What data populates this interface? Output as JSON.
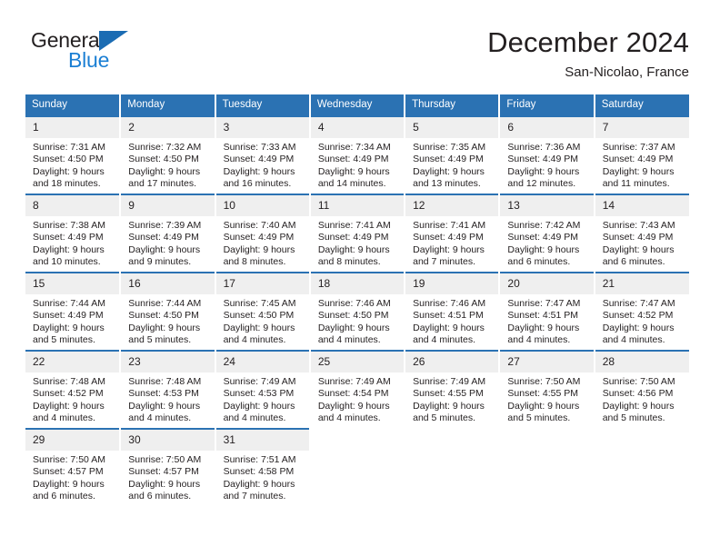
{
  "brand": {
    "line1": "General",
    "line2": "Blue",
    "triangle_color": "#1b6cb3",
    "line2_color": "#1b7fd4"
  },
  "header": {
    "title": "December 2024",
    "subtitle": "San-Nicolao, France"
  },
  "colors": {
    "header_blue": "#2b72b3",
    "daynum_band": "#efefef",
    "text": "#231f20"
  },
  "weekday_headers": [
    "Sunday",
    "Monday",
    "Tuesday",
    "Wednesday",
    "Thursday",
    "Friday",
    "Saturday"
  ],
  "weeks": [
    [
      {
        "day": "1",
        "sunrise": "Sunrise: 7:31 AM",
        "sunset": "Sunset: 4:50 PM",
        "daylight1": "Daylight: 9 hours",
        "daylight2": "and 18 minutes."
      },
      {
        "day": "2",
        "sunrise": "Sunrise: 7:32 AM",
        "sunset": "Sunset: 4:50 PM",
        "daylight1": "Daylight: 9 hours",
        "daylight2": "and 17 minutes."
      },
      {
        "day": "3",
        "sunrise": "Sunrise: 7:33 AM",
        "sunset": "Sunset: 4:49 PM",
        "daylight1": "Daylight: 9 hours",
        "daylight2": "and 16 minutes."
      },
      {
        "day": "4",
        "sunrise": "Sunrise: 7:34 AM",
        "sunset": "Sunset: 4:49 PM",
        "daylight1": "Daylight: 9 hours",
        "daylight2": "and 14 minutes."
      },
      {
        "day": "5",
        "sunrise": "Sunrise: 7:35 AM",
        "sunset": "Sunset: 4:49 PM",
        "daylight1": "Daylight: 9 hours",
        "daylight2": "and 13 minutes."
      },
      {
        "day": "6",
        "sunrise": "Sunrise: 7:36 AM",
        "sunset": "Sunset: 4:49 PM",
        "daylight1": "Daylight: 9 hours",
        "daylight2": "and 12 minutes."
      },
      {
        "day": "7",
        "sunrise": "Sunrise: 7:37 AM",
        "sunset": "Sunset: 4:49 PM",
        "daylight1": "Daylight: 9 hours",
        "daylight2": "and 11 minutes."
      }
    ],
    [
      {
        "day": "8",
        "sunrise": "Sunrise: 7:38 AM",
        "sunset": "Sunset: 4:49 PM",
        "daylight1": "Daylight: 9 hours",
        "daylight2": "and 10 minutes."
      },
      {
        "day": "9",
        "sunrise": "Sunrise: 7:39 AM",
        "sunset": "Sunset: 4:49 PM",
        "daylight1": "Daylight: 9 hours",
        "daylight2": "and 9 minutes."
      },
      {
        "day": "10",
        "sunrise": "Sunrise: 7:40 AM",
        "sunset": "Sunset: 4:49 PM",
        "daylight1": "Daylight: 9 hours",
        "daylight2": "and 8 minutes."
      },
      {
        "day": "11",
        "sunrise": "Sunrise: 7:41 AM",
        "sunset": "Sunset: 4:49 PM",
        "daylight1": "Daylight: 9 hours",
        "daylight2": "and 8 minutes."
      },
      {
        "day": "12",
        "sunrise": "Sunrise: 7:41 AM",
        "sunset": "Sunset: 4:49 PM",
        "daylight1": "Daylight: 9 hours",
        "daylight2": "and 7 minutes."
      },
      {
        "day": "13",
        "sunrise": "Sunrise: 7:42 AM",
        "sunset": "Sunset: 4:49 PM",
        "daylight1": "Daylight: 9 hours",
        "daylight2": "and 6 minutes."
      },
      {
        "day": "14",
        "sunrise": "Sunrise: 7:43 AM",
        "sunset": "Sunset: 4:49 PM",
        "daylight1": "Daylight: 9 hours",
        "daylight2": "and 6 minutes."
      }
    ],
    [
      {
        "day": "15",
        "sunrise": "Sunrise: 7:44 AM",
        "sunset": "Sunset: 4:49 PM",
        "daylight1": "Daylight: 9 hours",
        "daylight2": "and 5 minutes."
      },
      {
        "day": "16",
        "sunrise": "Sunrise: 7:44 AM",
        "sunset": "Sunset: 4:50 PM",
        "daylight1": "Daylight: 9 hours",
        "daylight2": "and 5 minutes."
      },
      {
        "day": "17",
        "sunrise": "Sunrise: 7:45 AM",
        "sunset": "Sunset: 4:50 PM",
        "daylight1": "Daylight: 9 hours",
        "daylight2": "and 4 minutes."
      },
      {
        "day": "18",
        "sunrise": "Sunrise: 7:46 AM",
        "sunset": "Sunset: 4:50 PM",
        "daylight1": "Daylight: 9 hours",
        "daylight2": "and 4 minutes."
      },
      {
        "day": "19",
        "sunrise": "Sunrise: 7:46 AM",
        "sunset": "Sunset: 4:51 PM",
        "daylight1": "Daylight: 9 hours",
        "daylight2": "and 4 minutes."
      },
      {
        "day": "20",
        "sunrise": "Sunrise: 7:47 AM",
        "sunset": "Sunset: 4:51 PM",
        "daylight1": "Daylight: 9 hours",
        "daylight2": "and 4 minutes."
      },
      {
        "day": "21",
        "sunrise": "Sunrise: 7:47 AM",
        "sunset": "Sunset: 4:52 PM",
        "daylight1": "Daylight: 9 hours",
        "daylight2": "and 4 minutes."
      }
    ],
    [
      {
        "day": "22",
        "sunrise": "Sunrise: 7:48 AM",
        "sunset": "Sunset: 4:52 PM",
        "daylight1": "Daylight: 9 hours",
        "daylight2": "and 4 minutes."
      },
      {
        "day": "23",
        "sunrise": "Sunrise: 7:48 AM",
        "sunset": "Sunset: 4:53 PM",
        "daylight1": "Daylight: 9 hours",
        "daylight2": "and 4 minutes."
      },
      {
        "day": "24",
        "sunrise": "Sunrise: 7:49 AM",
        "sunset": "Sunset: 4:53 PM",
        "daylight1": "Daylight: 9 hours",
        "daylight2": "and 4 minutes."
      },
      {
        "day": "25",
        "sunrise": "Sunrise: 7:49 AM",
        "sunset": "Sunset: 4:54 PM",
        "daylight1": "Daylight: 9 hours",
        "daylight2": "and 4 minutes."
      },
      {
        "day": "26",
        "sunrise": "Sunrise: 7:49 AM",
        "sunset": "Sunset: 4:55 PM",
        "daylight1": "Daylight: 9 hours",
        "daylight2": "and 5 minutes."
      },
      {
        "day": "27",
        "sunrise": "Sunrise: 7:50 AM",
        "sunset": "Sunset: 4:55 PM",
        "daylight1": "Daylight: 9 hours",
        "daylight2": "and 5 minutes."
      },
      {
        "day": "28",
        "sunrise": "Sunrise: 7:50 AM",
        "sunset": "Sunset: 4:56 PM",
        "daylight1": "Daylight: 9 hours",
        "daylight2": "and 5 minutes."
      }
    ],
    [
      {
        "day": "29",
        "sunrise": "Sunrise: 7:50 AM",
        "sunset": "Sunset: 4:57 PM",
        "daylight1": "Daylight: 9 hours",
        "daylight2": "and 6 minutes."
      },
      {
        "day": "30",
        "sunrise": "Sunrise: 7:50 AM",
        "sunset": "Sunset: 4:57 PM",
        "daylight1": "Daylight: 9 hours",
        "daylight2": "and 6 minutes."
      },
      {
        "day": "31",
        "sunrise": "Sunrise: 7:51 AM",
        "sunset": "Sunset: 4:58 PM",
        "daylight1": "Daylight: 9 hours",
        "daylight2": "and 7 minutes."
      },
      {
        "day": "",
        "sunrise": "",
        "sunset": "",
        "daylight1": "",
        "daylight2": ""
      },
      {
        "day": "",
        "sunrise": "",
        "sunset": "",
        "daylight1": "",
        "daylight2": ""
      },
      {
        "day": "",
        "sunrise": "",
        "sunset": "",
        "daylight1": "",
        "daylight2": ""
      },
      {
        "day": "",
        "sunrise": "",
        "sunset": "",
        "daylight1": "",
        "daylight2": ""
      }
    ]
  ]
}
